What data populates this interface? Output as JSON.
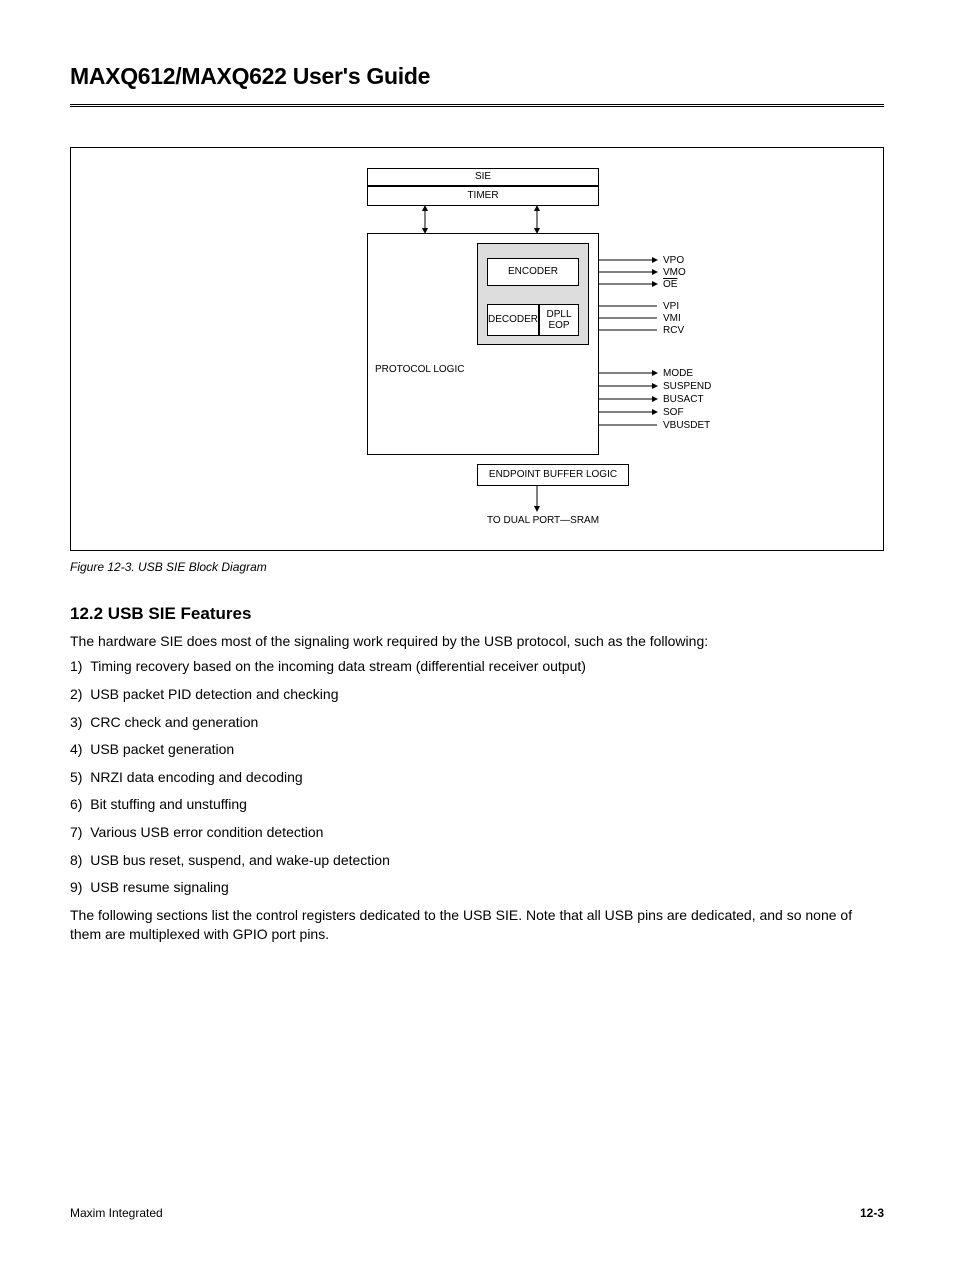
{
  "doc": {
    "title": "MAXQ612/MAXQ622 User's Guide"
  },
  "figure": {
    "caption": "Figure 12-3. USB SIE Block Diagram",
    "blocks": {
      "sie": "SIE",
      "timer": "TIMER",
      "protocol_logic": "PROTOCOL LOGIC",
      "encoder": "ENCODER",
      "decoder": "DECODER",
      "dpll_eop_l1": "DPLL",
      "dpll_eop_l2": "EOP",
      "endpoint_buffer": "ENDPOINT BUFFER LOGIC",
      "to_dual_port": "TO DUAL PORT—SRAM"
    },
    "signals": {
      "vpo": "VPO",
      "vmo": "VMO",
      "oe": "OE",
      "vpi": "VPI",
      "vmi": "VMI",
      "rcv": "RCV",
      "mode": "MODE",
      "suspend": "SUSPEND",
      "busact": "BUSACT",
      "sof": "SOF",
      "vbusdet": "VBUSDET"
    }
  },
  "section": {
    "heading": "12.2 USB SIE Features",
    "intro": "The hardware SIE does most of the signaling work required by the USB protocol, such as the following:",
    "items": [
      "Timing recovery based on the incoming data stream (differential receiver output)",
      "USB packet PID detection and checking",
      "CRC check and generation",
      "USB packet generation",
      "NRZI data encoding and decoding",
      "Bit stuffing and unstuffing",
      "Various USB error condition detection",
      "USB bus reset, suspend, and wake-up detection",
      "USB resume signaling"
    ],
    "outro": "The following sections list the control registers dedicated to the USB SIE. Note that all USB pins are dedicated, and so none of them are multiplexed with GPIO port pins."
  },
  "footer": {
    "left": "Maxim Integrated",
    "right": "12-3"
  }
}
